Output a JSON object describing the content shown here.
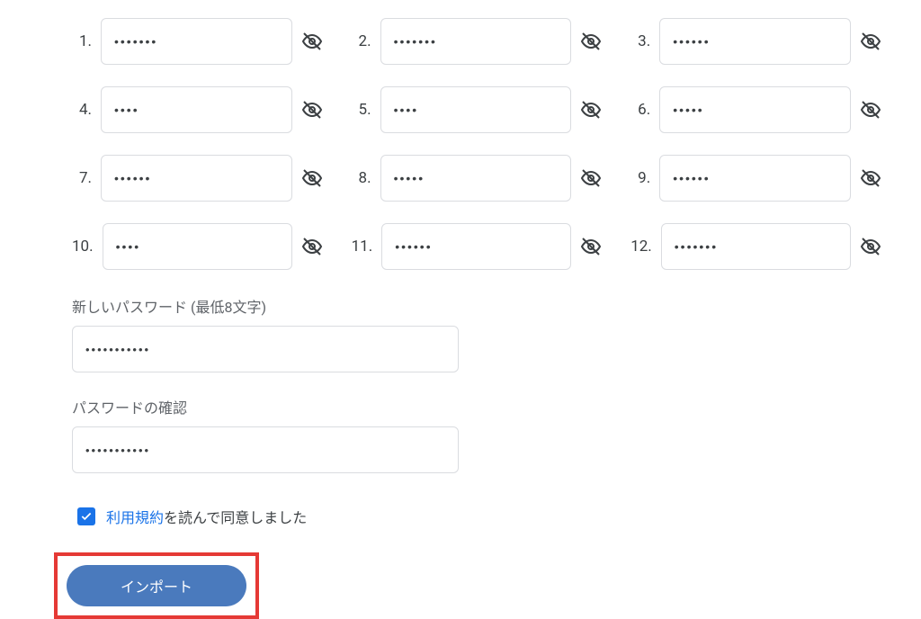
{
  "seed_words": [
    {
      "num": "1.",
      "value": "•••••••"
    },
    {
      "num": "2.",
      "value": "•••••••"
    },
    {
      "num": "3.",
      "value": "••••••"
    },
    {
      "num": "4.",
      "value": "••••"
    },
    {
      "num": "5.",
      "value": "••••"
    },
    {
      "num": "6.",
      "value": "•••••"
    },
    {
      "num": "7.",
      "value": "••••••"
    },
    {
      "num": "8.",
      "value": "•••••"
    },
    {
      "num": "9.",
      "value": "••••••"
    },
    {
      "num": "10.",
      "value": "••••"
    },
    {
      "num": "11.",
      "value": "••••••"
    },
    {
      "num": "12.",
      "value": "•••••••"
    }
  ],
  "password": {
    "new_label": "新しいパスワード (最低8文字)",
    "new_value": "•••••••••••",
    "confirm_label": "パスワードの確認",
    "confirm_value": "•••••••••••"
  },
  "terms": {
    "link_text": "利用規約",
    "suffix_text": "を読んで同意しました",
    "checked": true
  },
  "buttons": {
    "import": "インポート"
  }
}
